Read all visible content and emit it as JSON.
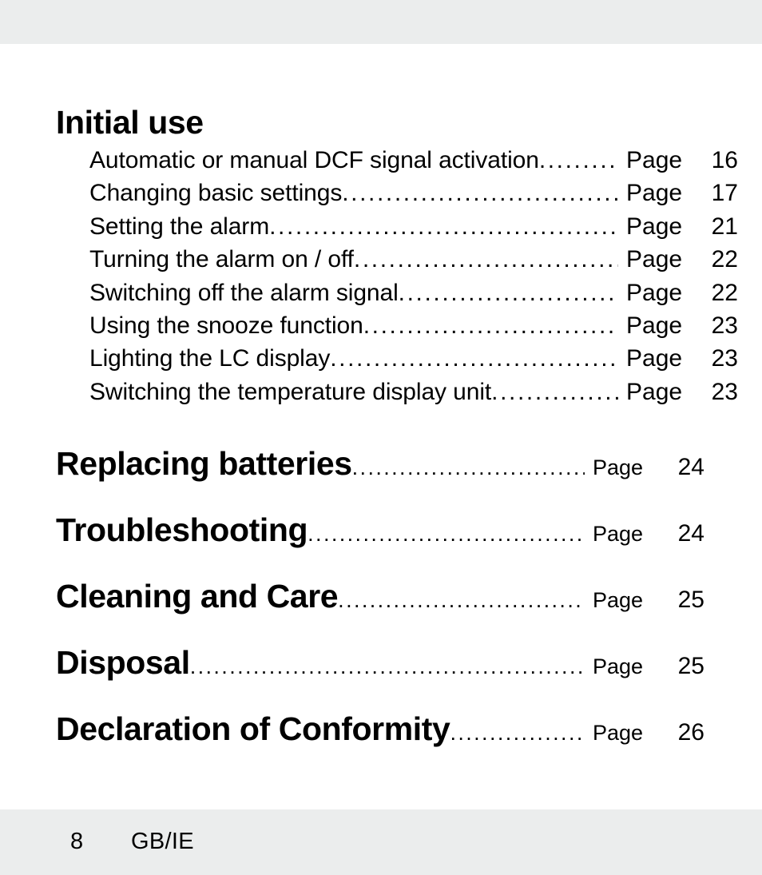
{
  "page": {
    "background_color": "#ffffff",
    "band_color": "#ebeded",
    "text_color": "#000000"
  },
  "toc": {
    "page_label": "Page",
    "sections": [
      {
        "title": "Initial use",
        "has_own_page": false,
        "entries": [
          {
            "label": "Automatic or manual DCF signal activation",
            "page_label": "Page",
            "page": "16"
          },
          {
            "label": "Changing basic settings",
            "page_label": "Page",
            "page": "17"
          },
          {
            "label": "Setting the alarm",
            "page_label": "Page",
            "page": "21"
          },
          {
            "label": "Turning the alarm on / off",
            "page_label": "Page",
            "page": "22"
          },
          {
            "label": "Switching off the alarm signal",
            "page_label": "Page",
            "page": "22"
          },
          {
            "label": "Using the snooze function",
            "page_label": "Page",
            "page": "23"
          },
          {
            "label": "Lighting the LC display",
            "page_label": "Page",
            "page": "23"
          },
          {
            "label": "Switching the temperature display unit",
            "page_label": "Page",
            "page": "23"
          }
        ]
      }
    ],
    "majors": [
      {
        "label": "Replacing batteries",
        "page_label": "Page",
        "page": "24"
      },
      {
        "label": "Troubleshooting",
        "page_label": "Page",
        "page": "24"
      },
      {
        "label": "Cleaning and Care",
        "page_label": "Page",
        "page": "25"
      },
      {
        "label": "Disposal",
        "page_label": "Page",
        "page": "25"
      },
      {
        "label": "Declaration of Conformity",
        "page_label": "Page",
        "page": "26"
      }
    ]
  },
  "footer": {
    "page_number": "8",
    "locale": "GB/IE"
  }
}
